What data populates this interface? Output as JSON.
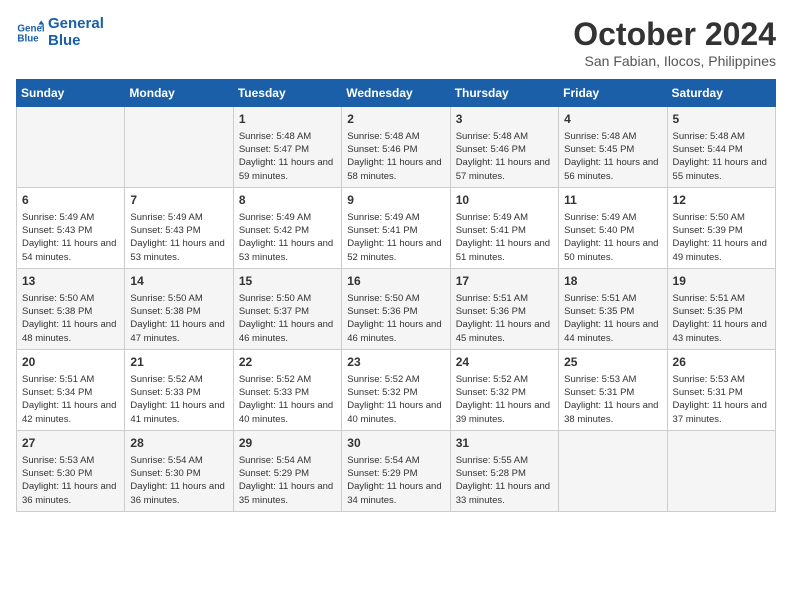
{
  "logo": {
    "line1": "General",
    "line2": "Blue"
  },
  "title": "October 2024",
  "subtitle": "San Fabian, Ilocos, Philippines",
  "headers": [
    "Sunday",
    "Monday",
    "Tuesday",
    "Wednesday",
    "Thursday",
    "Friday",
    "Saturday"
  ],
  "weeks": [
    [
      {
        "day": "",
        "info": ""
      },
      {
        "day": "",
        "info": ""
      },
      {
        "day": "1",
        "info": "Sunrise: 5:48 AM\nSunset: 5:47 PM\nDaylight: 11 hours and 59 minutes."
      },
      {
        "day": "2",
        "info": "Sunrise: 5:48 AM\nSunset: 5:46 PM\nDaylight: 11 hours and 58 minutes."
      },
      {
        "day": "3",
        "info": "Sunrise: 5:48 AM\nSunset: 5:46 PM\nDaylight: 11 hours and 57 minutes."
      },
      {
        "day": "4",
        "info": "Sunrise: 5:48 AM\nSunset: 5:45 PM\nDaylight: 11 hours and 56 minutes."
      },
      {
        "day": "5",
        "info": "Sunrise: 5:48 AM\nSunset: 5:44 PM\nDaylight: 11 hours and 55 minutes."
      }
    ],
    [
      {
        "day": "6",
        "info": "Sunrise: 5:49 AM\nSunset: 5:43 PM\nDaylight: 11 hours and 54 minutes."
      },
      {
        "day": "7",
        "info": "Sunrise: 5:49 AM\nSunset: 5:43 PM\nDaylight: 11 hours and 53 minutes."
      },
      {
        "day": "8",
        "info": "Sunrise: 5:49 AM\nSunset: 5:42 PM\nDaylight: 11 hours and 53 minutes."
      },
      {
        "day": "9",
        "info": "Sunrise: 5:49 AM\nSunset: 5:41 PM\nDaylight: 11 hours and 52 minutes."
      },
      {
        "day": "10",
        "info": "Sunrise: 5:49 AM\nSunset: 5:41 PM\nDaylight: 11 hours and 51 minutes."
      },
      {
        "day": "11",
        "info": "Sunrise: 5:49 AM\nSunset: 5:40 PM\nDaylight: 11 hours and 50 minutes."
      },
      {
        "day": "12",
        "info": "Sunrise: 5:50 AM\nSunset: 5:39 PM\nDaylight: 11 hours and 49 minutes."
      }
    ],
    [
      {
        "day": "13",
        "info": "Sunrise: 5:50 AM\nSunset: 5:38 PM\nDaylight: 11 hours and 48 minutes."
      },
      {
        "day": "14",
        "info": "Sunrise: 5:50 AM\nSunset: 5:38 PM\nDaylight: 11 hours and 47 minutes."
      },
      {
        "day": "15",
        "info": "Sunrise: 5:50 AM\nSunset: 5:37 PM\nDaylight: 11 hours and 46 minutes."
      },
      {
        "day": "16",
        "info": "Sunrise: 5:50 AM\nSunset: 5:36 PM\nDaylight: 11 hours and 46 minutes."
      },
      {
        "day": "17",
        "info": "Sunrise: 5:51 AM\nSunset: 5:36 PM\nDaylight: 11 hours and 45 minutes."
      },
      {
        "day": "18",
        "info": "Sunrise: 5:51 AM\nSunset: 5:35 PM\nDaylight: 11 hours and 44 minutes."
      },
      {
        "day": "19",
        "info": "Sunrise: 5:51 AM\nSunset: 5:35 PM\nDaylight: 11 hours and 43 minutes."
      }
    ],
    [
      {
        "day": "20",
        "info": "Sunrise: 5:51 AM\nSunset: 5:34 PM\nDaylight: 11 hours and 42 minutes."
      },
      {
        "day": "21",
        "info": "Sunrise: 5:52 AM\nSunset: 5:33 PM\nDaylight: 11 hours and 41 minutes."
      },
      {
        "day": "22",
        "info": "Sunrise: 5:52 AM\nSunset: 5:33 PM\nDaylight: 11 hours and 40 minutes."
      },
      {
        "day": "23",
        "info": "Sunrise: 5:52 AM\nSunset: 5:32 PM\nDaylight: 11 hours and 40 minutes."
      },
      {
        "day": "24",
        "info": "Sunrise: 5:52 AM\nSunset: 5:32 PM\nDaylight: 11 hours and 39 minutes."
      },
      {
        "day": "25",
        "info": "Sunrise: 5:53 AM\nSunset: 5:31 PM\nDaylight: 11 hours and 38 minutes."
      },
      {
        "day": "26",
        "info": "Sunrise: 5:53 AM\nSunset: 5:31 PM\nDaylight: 11 hours and 37 minutes."
      }
    ],
    [
      {
        "day": "27",
        "info": "Sunrise: 5:53 AM\nSunset: 5:30 PM\nDaylight: 11 hours and 36 minutes."
      },
      {
        "day": "28",
        "info": "Sunrise: 5:54 AM\nSunset: 5:30 PM\nDaylight: 11 hours and 36 minutes."
      },
      {
        "day": "29",
        "info": "Sunrise: 5:54 AM\nSunset: 5:29 PM\nDaylight: 11 hours and 35 minutes."
      },
      {
        "day": "30",
        "info": "Sunrise: 5:54 AM\nSunset: 5:29 PM\nDaylight: 11 hours and 34 minutes."
      },
      {
        "day": "31",
        "info": "Sunrise: 5:55 AM\nSunset: 5:28 PM\nDaylight: 11 hours and 33 minutes."
      },
      {
        "day": "",
        "info": ""
      },
      {
        "day": "",
        "info": ""
      }
    ]
  ]
}
